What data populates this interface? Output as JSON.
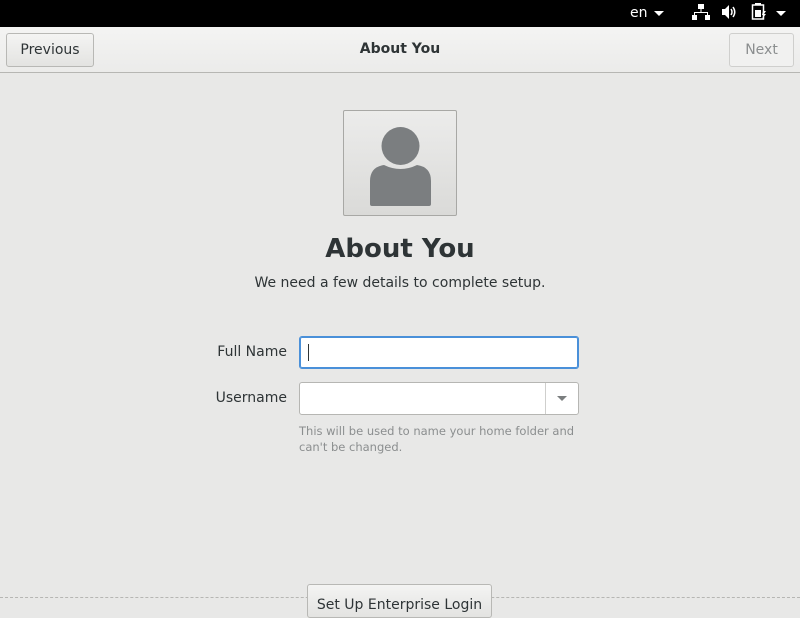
{
  "system_bar": {
    "language": "en",
    "tray_icons": [
      "network-icon",
      "volume-icon",
      "battery-icon"
    ]
  },
  "header": {
    "title": "About You",
    "previous_label": "Previous",
    "next_label": "Next"
  },
  "main": {
    "avatar_icon": "user-avatar-icon",
    "title": "About You",
    "subtitle": "We need a few details to complete setup.",
    "full_name": {
      "label": "Full Name",
      "value": ""
    },
    "username": {
      "label": "Username",
      "value": "",
      "hint": "This will be used to name your home folder and can't be changed."
    },
    "enterprise_button_label": "Set Up Enterprise Login"
  },
  "colors": {
    "background": "#e8e8e7",
    "focus": "#4a90d9",
    "text": "#2e3436",
    "disabled_text": "#8b8e8f"
  }
}
